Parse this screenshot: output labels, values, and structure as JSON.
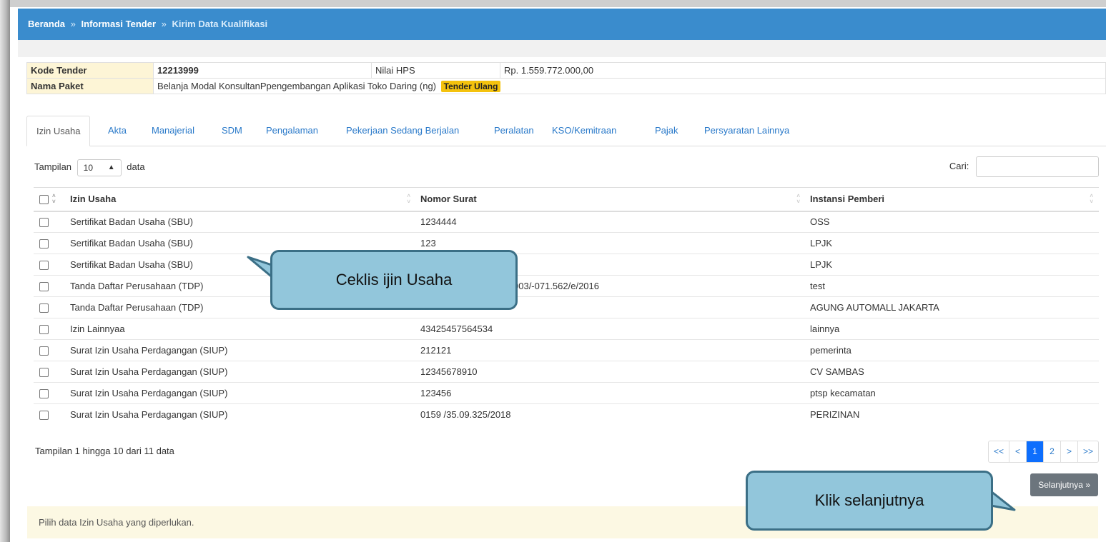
{
  "breadcrumb": {
    "home": "Beranda",
    "sep": "»",
    "section": "Informasi Tender",
    "current": "Kirim Data Kualifikasi"
  },
  "tender": {
    "kode_label": "Kode Tender",
    "kode_value": "12213999",
    "nilai_label": "Nilai HPS",
    "nilai_value": "Rp. 1.559.772.000,00",
    "paket_label": "Nama Paket",
    "paket_value": "Belanja Modal KonsultanPpengembangan Aplikasi Toko Daring (ng)",
    "badge": "Tender Ulang"
  },
  "tabs": [
    "Izin Usaha",
    "Akta",
    "Manajerial",
    "SDM",
    "Pengalaman",
    "Pekerjaan Sedang Berjalan",
    "Peralatan",
    "KSO/Kemitraan",
    "Pajak",
    "Persyaratan Lainnya"
  ],
  "table_controls": {
    "length_prefix": "Tampilan",
    "length_value": "10",
    "length_suffix": "data",
    "search_label": "Cari:"
  },
  "columns": [
    "Izin Usaha",
    "Nomor Surat",
    "Instansi Pemberi"
  ],
  "rows": [
    [
      "Sertifikat Badan Usaha (SBU)",
      "1234444",
      "OSS"
    ],
    [
      "Sertifikat Badan Usaha (SBU)",
      "123",
      "LPJK"
    ],
    [
      "Sertifikat Badan Usaha (SBU)",
      "",
      "LPJK"
    ],
    [
      "Tanda Daftar Perusahaan (TDP)",
      "003/-071.562/e/2016",
      "test"
    ],
    [
      "Tanda Daftar Perusahaan (TDP)",
      "",
      "AGUNG AUTOMALL JAKARTA"
    ],
    [
      "Izin Lainnyaa",
      "43425457564534",
      "lainnya"
    ],
    [
      "Surat Izin Usaha Perdagangan (SIUP)",
      "212121",
      "pemerinta"
    ],
    [
      "Surat Izin Usaha Perdagangan (SIUP)",
      "12345678910",
      "CV SAMBAS"
    ],
    [
      "Surat Izin Usaha Perdagangan (SIUP)",
      "123456",
      "ptsp kecamatan"
    ],
    [
      "Surat Izin Usaha Perdagangan (SIUP)",
      "0159 /35.09.325/2018",
      "PERIZINAN"
    ]
  ],
  "footer": {
    "info": "Tampilan 1 hingga 10 dari 11 data",
    "pager": [
      "<<",
      "<",
      "1",
      "2",
      ">",
      ">>"
    ],
    "pager_active": "1",
    "next_button": "Selanjutnya »"
  },
  "alert": "Pilih data Izin Usaha yang diperlukan.",
  "callouts": {
    "checklist": "Ceklis ijin Usaha",
    "next": "Klik selanjutnya"
  }
}
